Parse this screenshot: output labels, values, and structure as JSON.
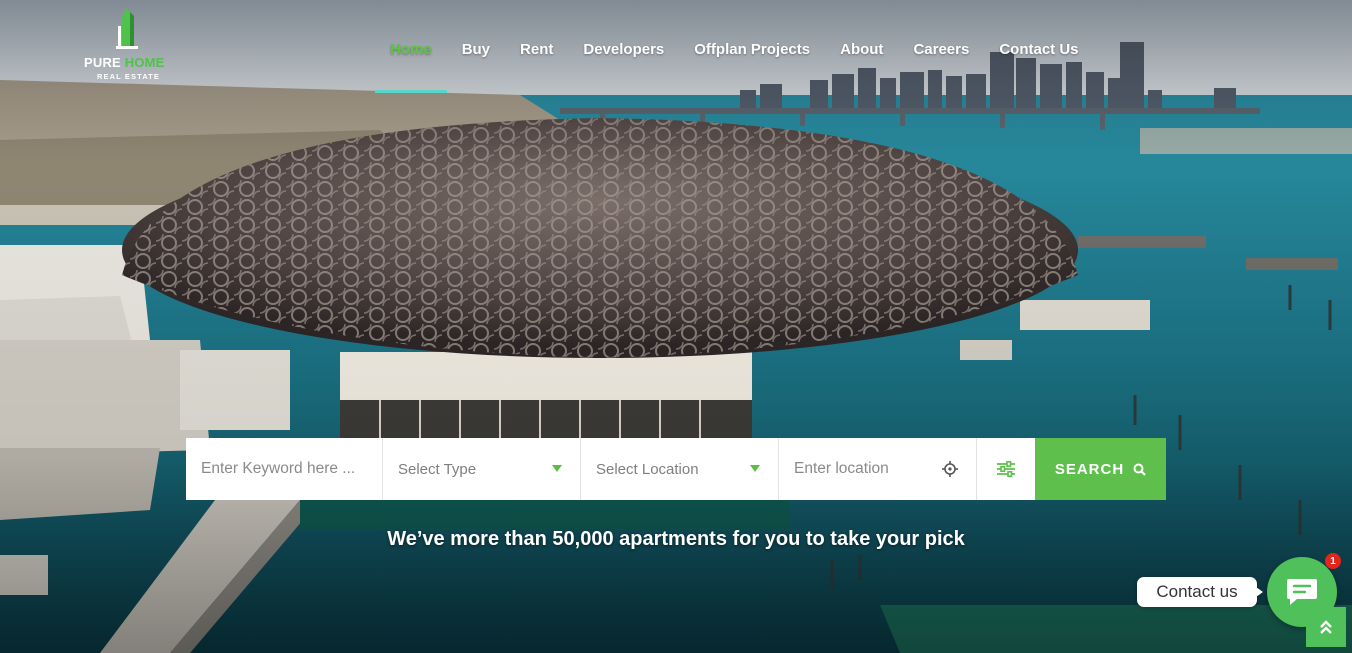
{
  "header": {
    "logo_brand_main": "PURE ",
    "logo_brand_accent": "HOME",
    "logo_tagline": "REAL ESTATE",
    "nav": [
      {
        "label": "Home",
        "active": true
      },
      {
        "label": "Buy"
      },
      {
        "label": "Rent"
      },
      {
        "label": "Developers"
      },
      {
        "label": "Offplan Projects"
      },
      {
        "label": "About"
      },
      {
        "label": "Careers"
      },
      {
        "label": "Contact Us"
      }
    ]
  },
  "search": {
    "keyword_placeholder": "Enter Keyword here ...",
    "type_selected": "Select Type",
    "location_selected": "Select Location",
    "near_placeholder": "Enter location",
    "button_label": "SEARCH",
    "icons": {
      "type_caret": "caret-down-icon",
      "location_caret": "caret-down-icon",
      "locate": "crosshair-icon",
      "advanced": "sliders-icon",
      "search": "search-icon"
    }
  },
  "hero": {
    "tagline": "We’ve more than 50,000 apartments for you to take your pick"
  },
  "contact_widget": {
    "label": "Contact us",
    "badge_count": "1",
    "icon": "chat-icon"
  },
  "back_to_top_icon": "double-chevron-up-icon",
  "colors": {
    "accent_green": "#5fbf4d",
    "nav_underline": "#55d6c8",
    "badge_red": "#e2261b"
  }
}
